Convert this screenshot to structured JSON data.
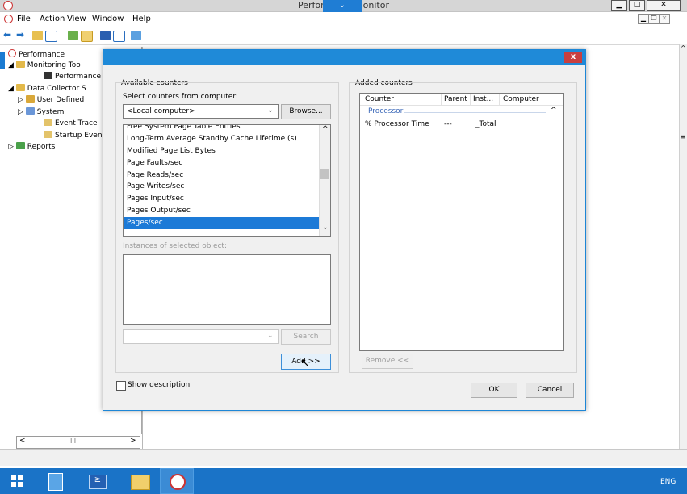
{
  "window": {
    "title": "Performance Monitor",
    "title_part1": "Perfor",
    "title_part2": "onitor",
    "minimize": "▁",
    "maximize": "□",
    "close": "✕"
  },
  "menu": [
    "File",
    "Action",
    "View",
    "Window",
    "Help"
  ],
  "mdi_buttons": {
    "minimize": "▁",
    "restore": "❐",
    "close": "✕"
  },
  "tree": {
    "root": "Performance",
    "monitoring_tools": "Monitoring Too",
    "performance_monitor": "Performance",
    "data_collector": "Data Collector S",
    "user_defined": "User Defined",
    "system": "System",
    "event_trace": "Event Trace",
    "startup_event": "Startup Even",
    "reports": "Reports"
  },
  "dialog": {
    "close_label": "x",
    "available_counters": "Available counters",
    "select_from_computer": "Select counters from computer:",
    "computer_value": "<Local computer>",
    "browse_label": "Browse...",
    "counters": [
      "Free System Page Table Entries",
      "Long-Term Average Standby Cache Lifetime (s)",
      "Modified Page List Bytes",
      "Page Faults/sec",
      "Page Reads/sec",
      "Page Writes/sec",
      "Pages Input/sec",
      "Pages Output/sec",
      "Pages/sec"
    ],
    "selected_counter": "Pages/sec",
    "instances_label": "Instances of selected object:",
    "search_label": "Search",
    "add_label": "Add >>",
    "added_counters": "Added counters",
    "columns": [
      "Counter",
      "Parent",
      "Inst...",
      "Computer"
    ],
    "group_name": "Processor",
    "added_row": {
      "counter": "% Processor Time",
      "parent": "---",
      "instance": "_Total",
      "computer": ""
    },
    "remove_label": "Remove <<",
    "show_description": "Show description",
    "ok_label": "OK",
    "cancel_label": "Cancel"
  },
  "tree_scroll_grip": "III",
  "taskbar": {
    "language": "ENG",
    "apps": [
      "start",
      "server-manager",
      "powershell",
      "file-explorer",
      "performance-monitor"
    ]
  },
  "colors": {
    "accent_blue": "#1f8ad8",
    "selection_blue": "#1c7ad7",
    "taskbar_blue": "#1a73c7",
    "close_red": "#c93f3f",
    "group_blue": "#3b68b8"
  }
}
